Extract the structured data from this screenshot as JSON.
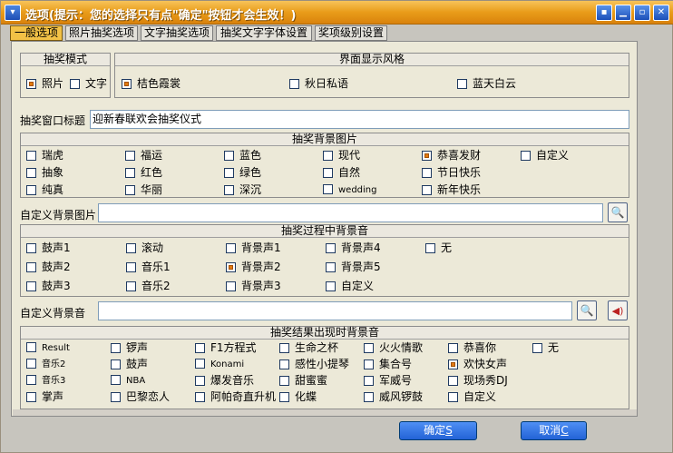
{
  "window": {
    "title": "选项(提示：您的选择只有点\"确定\"按钮才会生效！)"
  },
  "tabs": [
    "一般选项",
    "照片抽奖选项",
    "文字抽奖选项",
    "抽奖文字字体设置",
    "奖项级别设置"
  ],
  "mode": {
    "header": "抽奖模式",
    "options": [
      {
        "label": "照片",
        "checked": true
      },
      {
        "label": "文字",
        "checked": false
      }
    ]
  },
  "style": {
    "header": "界面显示风格",
    "options": [
      {
        "label": "桔色霞裳",
        "checked": true
      },
      {
        "label": "秋日私语",
        "checked": false
      },
      {
        "label": "蓝天白云",
        "checked": false
      }
    ]
  },
  "title_field": {
    "label": "抽奖窗口标题",
    "value": "迎新春联欢会抽奖仪式"
  },
  "bg_image": {
    "header": "抽奖背景图片",
    "options": [
      {
        "label": "瑞虎",
        "checked": false
      },
      {
        "label": "福运",
        "checked": false
      },
      {
        "label": "蓝色",
        "checked": false
      },
      {
        "label": "现代",
        "checked": false
      },
      {
        "label": "恭喜发财",
        "checked": true
      },
      {
        "label": "自定义",
        "checked": false
      },
      {
        "label": "抽象",
        "checked": false
      },
      {
        "label": "红色",
        "checked": false
      },
      {
        "label": "绿色",
        "checked": false
      },
      {
        "label": "自然",
        "checked": false
      },
      {
        "label": "节日快乐",
        "checked": false
      },
      {
        "label": "纯真",
        "checked": false
      },
      {
        "label": "华丽",
        "checked": false
      },
      {
        "label": "深沉",
        "checked": false
      },
      {
        "label": "wedding",
        "checked": false
      },
      {
        "label": "新年快乐",
        "checked": false
      }
    ]
  },
  "custom_bg_image": {
    "label": "自定义背景图片",
    "value": ""
  },
  "process_sound": {
    "header": "抽奖过程中背景音",
    "options": [
      {
        "label": "鼓声1",
        "checked": false
      },
      {
        "label": "滚动",
        "checked": false
      },
      {
        "label": "背景声1",
        "checked": false
      },
      {
        "label": "背景声4",
        "checked": false
      },
      {
        "label": "无",
        "checked": false
      },
      {
        "label": "鼓声2",
        "checked": false
      },
      {
        "label": "音乐1",
        "checked": false
      },
      {
        "label": "背景声2",
        "checked": true
      },
      {
        "label": "背景声5",
        "checked": false
      },
      {
        "label": "鼓声3",
        "checked": false
      },
      {
        "label": "音乐2",
        "checked": false
      },
      {
        "label": "背景声3",
        "checked": false
      },
      {
        "label": "自定义",
        "checked": false
      }
    ]
  },
  "custom_bg_sound": {
    "label": "自定义背景音",
    "value": ""
  },
  "result_sound": {
    "header": "抽奖结果出现时背景音",
    "options": [
      {
        "label": "Result",
        "checked": false
      },
      {
        "label": "锣声",
        "checked": false
      },
      {
        "label": "F1方程式",
        "checked": false
      },
      {
        "label": "生命之杯",
        "checked": false
      },
      {
        "label": "火火情歌",
        "checked": false
      },
      {
        "label": "恭喜你",
        "checked": false
      },
      {
        "label": "无",
        "checked": false
      },
      {
        "label": "音乐2",
        "checked": false
      },
      {
        "label": "鼓声",
        "checked": false
      },
      {
        "label": "Konami",
        "checked": false
      },
      {
        "label": "感性小提琴",
        "checked": false
      },
      {
        "label": "集合号",
        "checked": false
      },
      {
        "label": "欢快女声",
        "checked": true
      },
      {
        "label": "音乐3",
        "checked": false
      },
      {
        "label": "NBA",
        "checked": false
      },
      {
        "label": "爆发音乐",
        "checked": false
      },
      {
        "label": "甜蜜蜜",
        "checked": false
      },
      {
        "label": "军威号",
        "checked": false
      },
      {
        "label": "现场秀DJ",
        "checked": false
      },
      {
        "label": "掌声",
        "checked": false
      },
      {
        "label": "巴黎恋人",
        "checked": false
      },
      {
        "label": "阿帕奇直升机",
        "checked": false
      },
      {
        "label": "化蝶",
        "checked": false
      },
      {
        "label": "威风锣鼓",
        "checked": false
      },
      {
        "label": "自定义",
        "checked": false
      }
    ]
  },
  "buttons": {
    "ok": "确定S",
    "ok_main": "确定",
    "ok_key": "S",
    "cancel": "取消C",
    "cancel_main": "取消",
    "cancel_key": "C"
  },
  "colors": {
    "titlebar": "#e99c19",
    "active_tab": "#f2c146",
    "radio_dot": "#e27a10",
    "button": "#2363d6"
  }
}
